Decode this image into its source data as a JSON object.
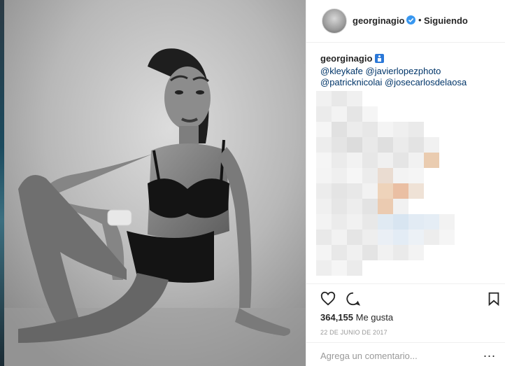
{
  "post": {
    "username": "georginagio",
    "follow_dot": "•",
    "follow_state": "Siguiendo",
    "caption_user": "georginagio",
    "mentions_line1": [
      "@kleykafe",
      "@javierlopezphoto"
    ],
    "mentions_line2": [
      "@patricknicolai",
      "@josecarlosdelaosa"
    ],
    "likes_count": "364,155",
    "likes_label": "Me gusta",
    "date": "22 DE JUNIO DE 2017",
    "comment_placeholder": "Agrega un comentario...",
    "more_label": "..."
  },
  "colors": {
    "mention": "#003569",
    "verified": "#3897f0",
    "border": "#efefef"
  },
  "icons": [
    "heart-icon",
    "comment-icon",
    "bookmark-icon",
    "verified-badge-icon",
    "person-emoji-icon"
  ]
}
